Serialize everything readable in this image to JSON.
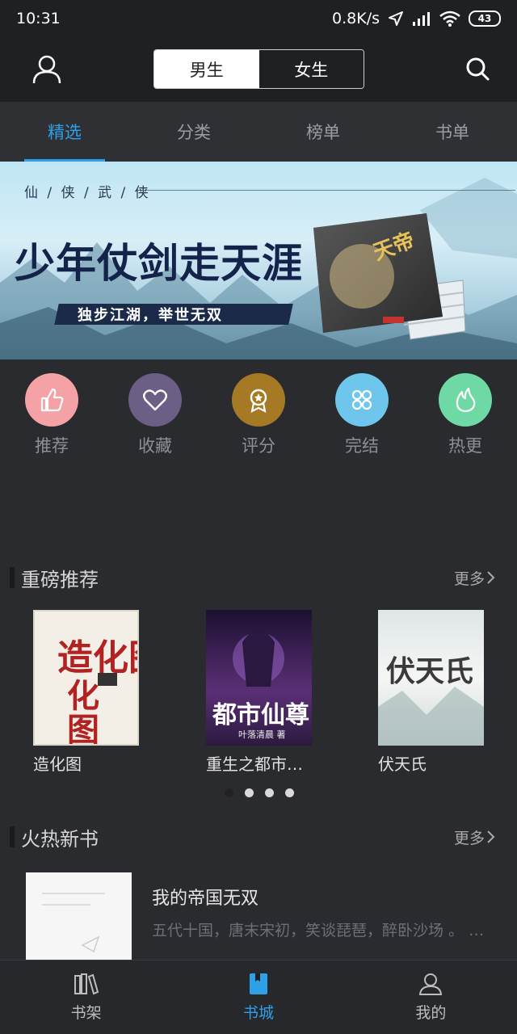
{
  "status_bar": {
    "time": "10:31",
    "network_speed": "0.8K/s",
    "battery": "43"
  },
  "header": {
    "segments": [
      "男生",
      "女生"
    ],
    "selected_segment": "男生"
  },
  "tabs": [
    "精选",
    "分类",
    "榜单",
    "书单"
  ],
  "active_tab": "精选",
  "banner": {
    "genre": "仙 / 侠 / 武 / 侠",
    "headline": "少年仗剑走天涯",
    "slogan": "独步江湖，举世无双",
    "slide_count": 5,
    "current_slide": 1
  },
  "quick_entries": [
    {
      "label": "推荐",
      "icon": "thumbs-up-icon",
      "color": "#f4a2a6"
    },
    {
      "label": "收藏",
      "icon": "heart-icon",
      "color": "#6b5f86"
    },
    {
      "label": "评分",
      "icon": "medal-icon",
      "color": "#a67a24"
    },
    {
      "label": "完结",
      "icon": "clover-icon",
      "color": "#6fc6ec"
    },
    {
      "label": "热更",
      "icon": "flame-icon",
      "color": "#6fd9a5"
    }
  ],
  "featured": {
    "title": "重磅推荐",
    "more": "更多",
    "books": [
      {
        "title": "造化图",
        "cover_text": "造化图"
      },
      {
        "title": "重生之都市…",
        "cover_text": "都市仙尊"
      },
      {
        "title": "伏天氏",
        "cover_text": "伏天氏"
      }
    ],
    "page_count": 4,
    "current_page": 1
  },
  "new_books": {
    "title": "火热新书",
    "more": "更多",
    "items": [
      {
        "title": "我的帝国无双",
        "desc": "五代十国，唐末宋初，笑谈琵琶，醉卧沙场 。 …"
      }
    ]
  },
  "bottom_nav": [
    "书架",
    "书城",
    "我的"
  ],
  "active_nav": "书城",
  "accent_color": "#2ea0e8"
}
